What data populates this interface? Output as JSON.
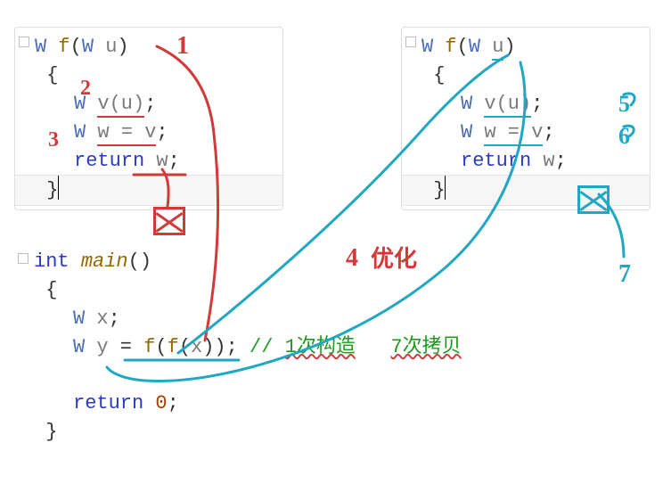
{
  "left_panel": {
    "line1_type": "W",
    "line1_fn": "f",
    "line1_open": "(",
    "line1_ptyp": "W",
    "line1_pid": "u",
    "line1_close": ")",
    "line2_brace": "{",
    "line3_type": "W",
    "line3_call": "v(u)",
    "line3_semi": ";",
    "line4_type": "W",
    "line4_decl": "w = v",
    "line4_semi": ";",
    "line5_kw": "return",
    "line5_id": " w",
    "line5_semi": ";",
    "line6_brace": "}"
  },
  "right_panel": {
    "line1_type": "W",
    "line1_fn": "f",
    "line1_open": "(",
    "line1_ptyp": "W",
    "line1_pid": "u",
    "line1_close": ")",
    "line2_brace": "{",
    "line3_type": "W",
    "line3_call": "v(u)",
    "line3_semi": ";",
    "line4_type": "W",
    "line4_decl": "w = v",
    "line4_semi": ";",
    "line5_kw": "return",
    "line5_id": " w",
    "line5_semi": ";",
    "line6_brace": "}"
  },
  "main_block": {
    "line1_kw": "int",
    "line1_fn": "main",
    "line1_paren": "()",
    "line2_brace": "{",
    "line3_type": "W",
    "line3_decl": "x",
    "line3_semi": ";",
    "line4_type": "W",
    "line4_lhs": "y",
    "line4_eq": " = ",
    "line4_fn_out": "f",
    "line4_open": "(",
    "line4_fn_in": "f",
    "line4_open2": "(",
    "line4_arg": "x",
    "line4_close": "))",
    "line4_semi": ";",
    "line4_comment_slashes": "// ",
    "line4_comment_a": "1次构造",
    "line4_comment_gap": "   ",
    "line4_comment_b": "7次拷贝",
    "line6_kw": "return",
    "line6_zero": "0",
    "line6_semi": ";",
    "line7_brace": "}"
  },
  "hand": {
    "one": "1",
    "two": "2",
    "three": "3",
    "four": "4",
    "five": "5",
    "six": "6",
    "seven": "7",
    "opt": "优化"
  }
}
